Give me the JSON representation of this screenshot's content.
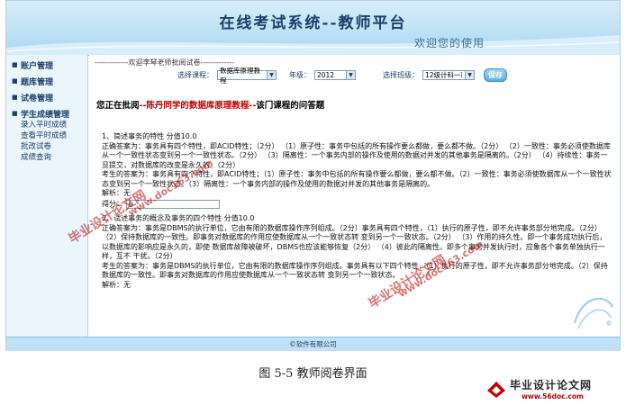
{
  "header": {
    "title": "在线考试系统--教师平台",
    "subtitle": "欢迎您的使用"
  },
  "sidebar": {
    "groups": [
      {
        "label": "账户管理",
        "items": []
      },
      {
        "label": "题库管理",
        "items": []
      },
      {
        "label": "试卷管理",
        "items": []
      },
      {
        "label": "学生成绩管理",
        "items": [
          "录入平时成绩",
          "查看平时成绩",
          "批改试卷",
          "成绩查询"
        ]
      }
    ]
  },
  "main": {
    "welcome": "-------------欢迎李琴老师批阅试卷-------------",
    "filters": {
      "course_label": "选择课程：",
      "course_value": "数据库原理教程",
      "grade_label": "年级：",
      "grade_value": "2012",
      "class_label": "选择班级：",
      "class_value": "12级计科一班",
      "save_label": "保存"
    },
    "heading_prefix": "您正在批阅",
    "heading_highlight": "--陈丹同学的数据库原理教程--",
    "heading_suffix": "该门课程的问答题",
    "questions": [
      {
        "title": "1、简述事务的特性      分值10.0",
        "answer": "正确答案为：事务具有四个特性，即ACID特性；（2分）  （1）原子性：事务中包括的所有操作要么都做，要么都不做。（2分）  （2）一致性：事务必须使数据库从一个一致性状态变到另一个一致性状态。（2分）  （3）隔离性：一个事务内部的操作及使用的数据对并发的其他事务是隔离的。（2分）  （4）持续性：事务一旦提交，对数据库的改变是永久的。（2分）",
        "student_answer": "考生的答案为：事务具有四个特性，即ACID特性；（1）原子性：事务中包括的所有操作要么都做，要么都不做。（2）一致性：事务必须使数据库从一个一致性状态变到另一个一致性状态。（3）隔离性：一个事务内部的操作及使用的数据对并发的其他事务是隔离的。",
        "analysis": "解析：无",
        "score_label": "得分：",
        "score_value": "0"
      },
      {
        "title": "2、试述事务的概念及事务的四个特性      分值10.0",
        "answer": "正确答案为：事务是DBMS的执行单位，它由有限的数据库操作序列组成。（2分）事务具有四个特性，（1）执行的原子性，即不允许事务部分地完成。（2分）（2）保持数据库的一致性。即事务对数据库的作用应使数据库从一个一致状态转 变到另一个一致状态。（2分）  （3）作用的持久性。即一个事务成功执行后，以数据库的影响应是永久的，即使 数据库故障被破坏，DBMS也应该能够恢复（2分）  （4）彼此的隔离性。即多个事务并发执行时，应象各个事务单独执行一样，互不 干扰。（2分）",
        "student_answer": "考生的答案为：事务是DBMS的执行单位，它由有限的数据库操作序列组成。事务具有以下四个特性，（1）执行的原子性，即不允许事务部分地完成。（2）保持数据库的一致性。即事务对数据库的作用应使数据库从一个一致状态转 变到另一个一致状态。",
        "analysis": "解析：无"
      }
    ]
  },
  "footer": "©软件有限公司",
  "caption": "图 5-5  教师阅卷界面",
  "watermark": {
    "text_a": "毕业设计论文网",
    "text_b": "www.doc163.com"
  },
  "logo": {
    "name": "毕业设计论文网",
    "url": "www.56doc.com"
  },
  "colors": {
    "banner": "#bfe2f6",
    "accent": "#1b3f6b",
    "highlight": "#c00000",
    "watermark": "#be0000"
  }
}
